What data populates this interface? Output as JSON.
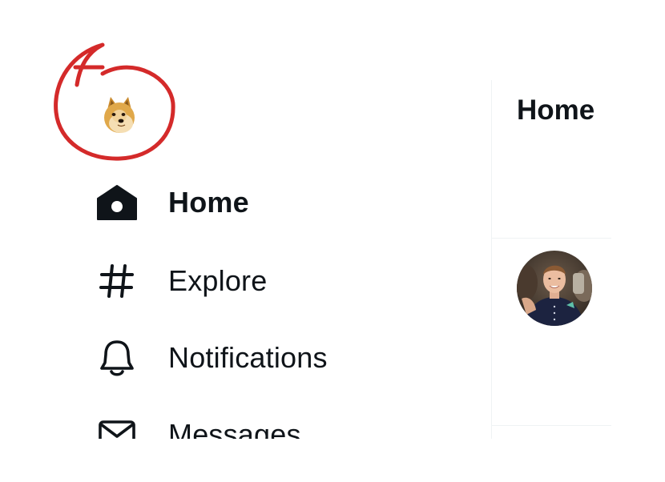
{
  "sidebar": {
    "logo_icon": "doge-logo-icon",
    "items": [
      {
        "label": "Home",
        "icon": "home-icon",
        "active": true
      },
      {
        "label": "Explore",
        "icon": "hashtag-icon",
        "active": false
      },
      {
        "label": "Notifications",
        "icon": "bell-icon",
        "active": false
      },
      {
        "label": "Messages",
        "icon": "envelope-icon",
        "active": false
      }
    ]
  },
  "main": {
    "header_title": "Home"
  },
  "annotation": {
    "color": "#d42a2a",
    "shape": "hand-drawn circle around logo"
  },
  "colors": {
    "text": "#0f1419",
    "divider": "#eff3f4"
  }
}
